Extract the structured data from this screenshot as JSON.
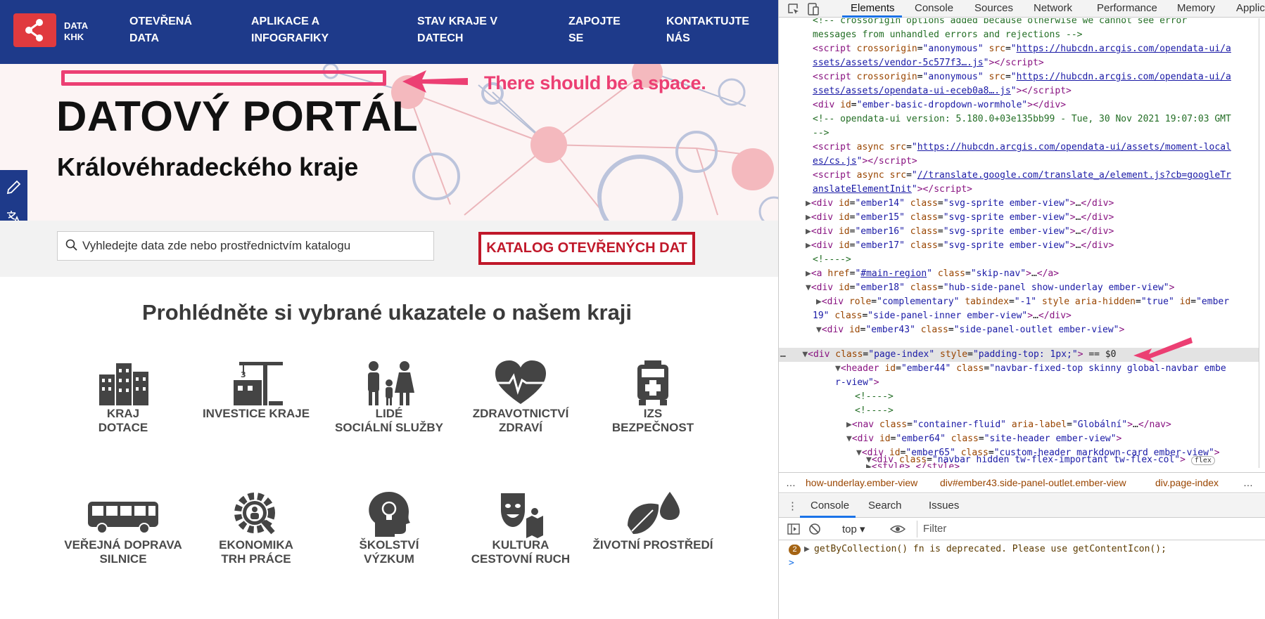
{
  "topnav": {
    "logo_line1": "DATA",
    "logo_line2": "KHK",
    "links": [
      {
        "line1": "OTEVŘENÁ",
        "line2": "DATA"
      },
      {
        "line1": "APLIKACE A",
        "line2": "INFOGRAFIKY"
      },
      {
        "line1": "STAV KRAJE V",
        "line2": "DATECH"
      },
      {
        "line1": "ZAPOJTE",
        "line2": "SE"
      },
      {
        "line1": "KONTAKTUJTE",
        "line2": "NÁS"
      }
    ]
  },
  "annotation": {
    "text": "There should be a space.",
    "color": "#ec3f73"
  },
  "hero": {
    "title": "DATOVÝ PORTÁL",
    "subtitle": "Královéhradeckého kraje"
  },
  "search": {
    "placeholder": "Vyhledejte data zde nebo prostřednictvím katalogu",
    "catalog_button": "KATALOG OTEVŘENÝCH DAT"
  },
  "section_heading": "Prohlédněte si vybrané ukazatele o našem kraji",
  "categories": [
    {
      "line1": "KRAJ",
      "line2": "DOTACE",
      "icon": "buildings-icon"
    },
    {
      "line1": "INVESTICE KRAJE",
      "line2": "",
      "icon": "crane-icon"
    },
    {
      "line1": "LIDÉ",
      "line2": "SOCIÁLNÍ SLUŽBY",
      "icon": "family-icon"
    },
    {
      "line1": "ZDRAVOTNICTVÍ",
      "line2": "ZDRAVÍ",
      "icon": "heart-pulse-icon"
    },
    {
      "line1": "IZS",
      "line2": "BEZPEČNOST",
      "icon": "ambulance-icon"
    },
    {
      "line1": "VEŘEJNÁ DOPRAVA",
      "line2": "SILNICE",
      "icon": "bus-icon"
    },
    {
      "line1": "EKONOMIKA",
      "line2": "TRH PRÁCE",
      "icon": "gear-magnifier-icon"
    },
    {
      "line1": "ŠKOLSTVÍ",
      "line2": "VÝZKUM",
      "icon": "head-lightbulb-icon"
    },
    {
      "line1": "KULTURA",
      "line2": "CESTOVNÍ RUCH",
      "icon": "theatre-map-icon"
    },
    {
      "line1": "ŽIVOTNÍ PROSTŘEDÍ",
      "line2": "",
      "icon": "leaf-drop-icon"
    }
  ],
  "devtools": {
    "tabs": [
      "Elements",
      "Console",
      "Sources",
      "Network",
      "Performance",
      "Memory",
      "Applic"
    ],
    "active_tab": "Elements",
    "breadcrumb": [
      "how-underlay.ember-view",
      "div#ember43.side-panel-outlet.ember-view",
      "div.page-index"
    ],
    "drawer_tabs": [
      "Console",
      "Search",
      "Issues"
    ],
    "context": "top",
    "filter_placeholder": "Filter",
    "message_count": "2",
    "message": "getByCollection() fn is deprecated. Please use getContentIcon();",
    "prompt": ">",
    "flex_badge": "flex"
  }
}
